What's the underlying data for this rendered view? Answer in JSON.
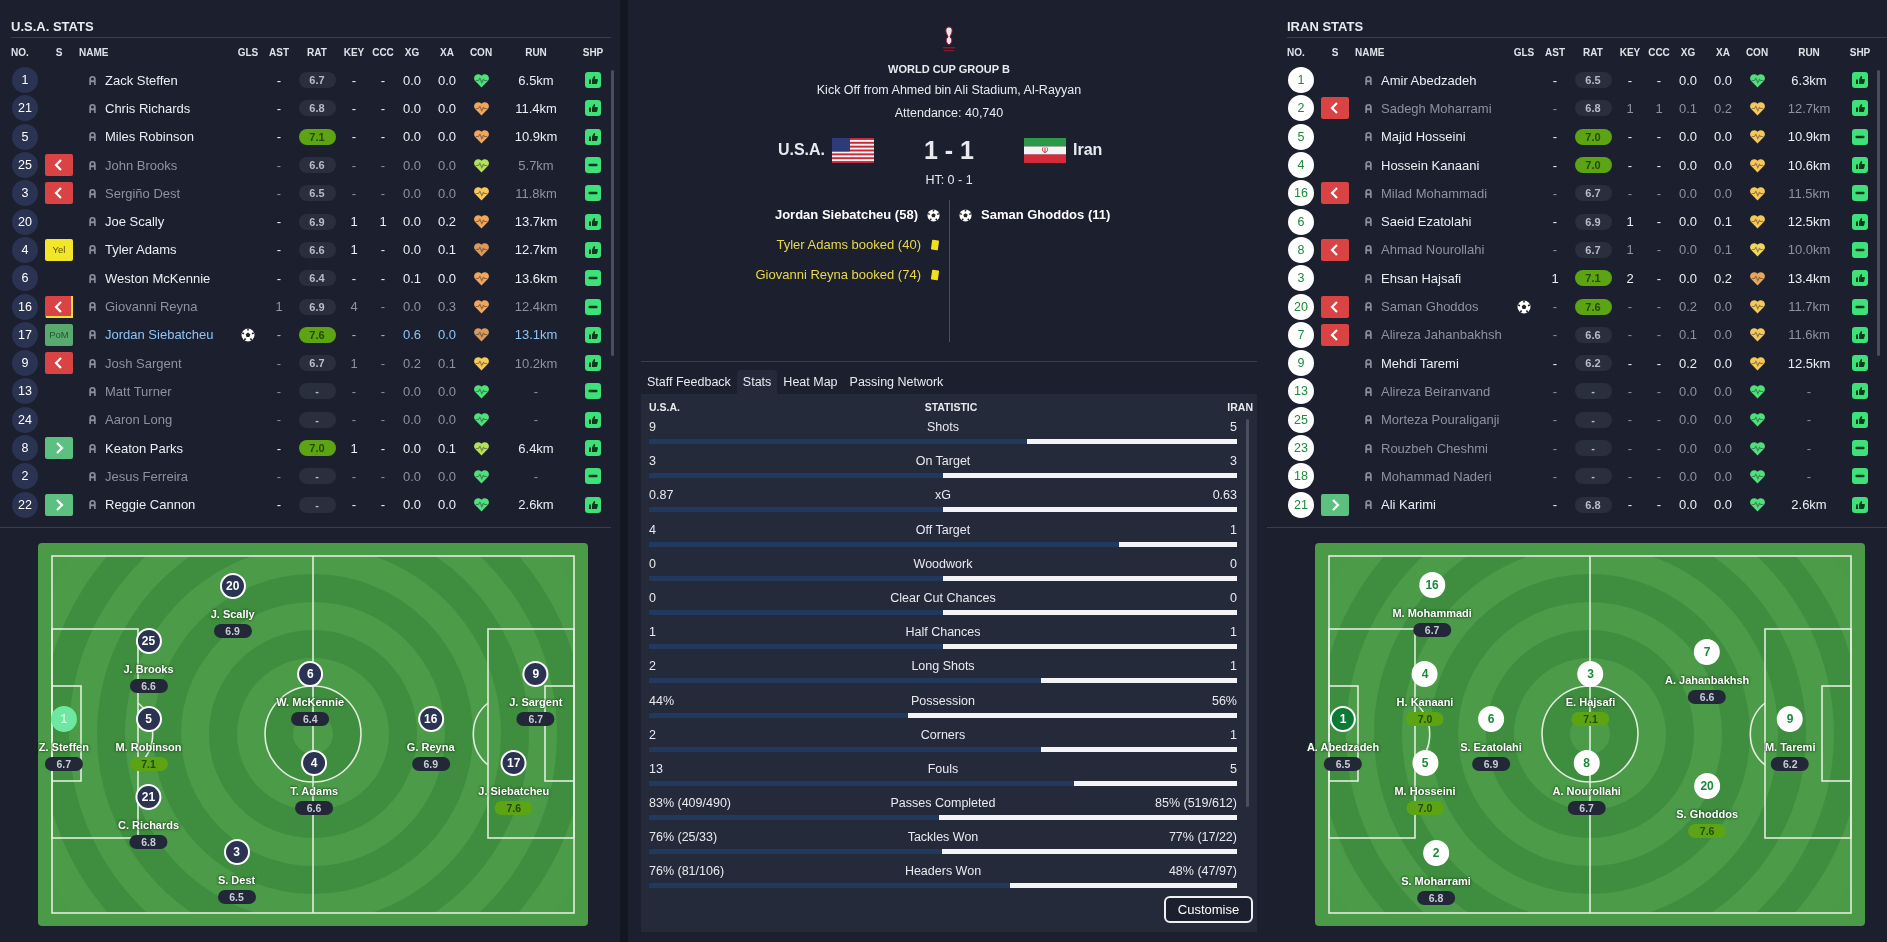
{
  "teams": [
    {
      "title": "U.S.A. STATS",
      "kind": "dark",
      "columns": [
        "NO.",
        "S",
        "NAME",
        "GLS",
        "AST",
        "RAT",
        "KEY",
        "CCC",
        "XG",
        "XA",
        "CON",
        "RUN",
        "SHP"
      ],
      "players": [
        {
          "no": "1",
          "name": "Zack Steffen",
          "status": {
            "kind": "none"
          },
          "booked": false,
          "faded": false,
          "highlighted": false,
          "scored": false,
          "ast": "-",
          "rat": "6.7",
          "rat_good": false,
          "key": "-",
          "ccc": "-",
          "xg": "0.0",
          "xa": "0.0",
          "condition": {
            "color": "#4fe07a"
          },
          "run": "6.5km",
          "shp": {
            "kind": "up"
          }
        },
        {
          "no": "21",
          "name": "Chris Richards",
          "status": {
            "kind": "none"
          },
          "booked": false,
          "faded": false,
          "highlighted": false,
          "scored": false,
          "ast": "-",
          "rat": "6.8",
          "rat_good": false,
          "key": "-",
          "ccc": "-",
          "xg": "0.0",
          "xa": "0.0",
          "condition": {
            "color": "#f2a65a"
          },
          "run": "11.4km",
          "shp": {
            "kind": "up"
          }
        },
        {
          "no": "5",
          "name": "Miles Robinson",
          "status": {
            "kind": "none"
          },
          "booked": false,
          "faded": false,
          "highlighted": false,
          "scored": false,
          "ast": "-",
          "rat": "7.1",
          "rat_good": true,
          "key": "-",
          "ccc": "-",
          "xg": "0.0",
          "xa": "0.0",
          "condition": {
            "color": "#f2a65a"
          },
          "run": "10.9km",
          "shp": {
            "kind": "up"
          }
        },
        {
          "no": "25",
          "name": "John Brooks",
          "status": {
            "kind": "off"
          },
          "booked": false,
          "faded": true,
          "highlighted": false,
          "scored": false,
          "ast": "-",
          "rat": "6.6",
          "rat_good": false,
          "key": "-",
          "ccc": "-",
          "xg": "0.0",
          "xa": "0.0",
          "condition": {
            "color": "#b5e05a"
          },
          "run": "5.7km",
          "shp": {
            "kind": "neutral"
          }
        },
        {
          "no": "3",
          "name": "Sergiño Dest",
          "status": {
            "kind": "off"
          },
          "booked": false,
          "faded": true,
          "highlighted": false,
          "scored": false,
          "ast": "-",
          "rat": "6.5",
          "rat_good": false,
          "key": "-",
          "ccc": "-",
          "xg": "0.0",
          "xa": "0.0",
          "condition": {
            "color": "#f6c85a"
          },
          "run": "11.8km",
          "shp": {
            "kind": "neutral"
          }
        },
        {
          "no": "20",
          "name": "Joe Scally",
          "status": {
            "kind": "none"
          },
          "booked": false,
          "faded": false,
          "highlighted": false,
          "scored": false,
          "ast": "-",
          "rat": "6.9",
          "rat_good": false,
          "key": "1",
          "ccc": "1",
          "xg": "0.0",
          "xa": "0.2",
          "condition": {
            "color": "#f2a65a"
          },
          "run": "13.7km",
          "shp": {
            "kind": "up"
          }
        },
        {
          "no": "4",
          "name": "Tyler Adams",
          "status": {
            "kind": "card",
            "text": "Yel"
          },
          "booked": false,
          "faded": false,
          "highlighted": false,
          "scored": false,
          "ast": "-",
          "rat": "6.6",
          "rat_good": false,
          "key": "1",
          "ccc": "-",
          "xg": "0.0",
          "xa": "0.1",
          "condition": {
            "color": "#d99a5a"
          },
          "run": "12.7km",
          "shp": {
            "kind": "up"
          }
        },
        {
          "no": "6",
          "name": "Weston McKennie",
          "status": {
            "kind": "none"
          },
          "booked": false,
          "faded": false,
          "highlighted": false,
          "scored": false,
          "ast": "-",
          "rat": "6.4",
          "rat_good": false,
          "key": "-",
          "ccc": "-",
          "xg": "0.1",
          "xa": "0.0",
          "condition": {
            "color": "#f2a65a"
          },
          "run": "13.6km",
          "shp": {
            "kind": "neutral"
          }
        },
        {
          "no": "16",
          "name": "Giovanni Reyna",
          "status": {
            "kind": "off"
          },
          "booked": true,
          "faded": true,
          "highlighted": false,
          "scored": false,
          "ast": "1",
          "rat": "6.9",
          "rat_good": false,
          "key": "4",
          "ccc": "-",
          "xg": "0.0",
          "xa": "0.3",
          "condition": {
            "color": "#f2a65a"
          },
          "run": "12.4km",
          "shp": {
            "kind": "neutral"
          }
        },
        {
          "no": "17",
          "name": "Jordan Siebatcheu",
          "status": {
            "kind": "award",
            "text": "PoM"
          },
          "booked": false,
          "faded": false,
          "highlighted": true,
          "scored": true,
          "ast": "-",
          "rat": "7.6",
          "rat_good": true,
          "key": "-",
          "ccc": "-",
          "xg": "0.6",
          "xa": "0.0",
          "condition": {
            "color": "#d99a5a"
          },
          "run": "13.1km",
          "shp": {
            "kind": "up"
          }
        },
        {
          "no": "9",
          "name": "Josh Sargent",
          "status": {
            "kind": "off"
          },
          "booked": false,
          "faded": true,
          "highlighted": false,
          "scored": false,
          "ast": "-",
          "rat": "6.7",
          "rat_good": false,
          "key": "1",
          "ccc": "-",
          "xg": "0.2",
          "xa": "0.1",
          "condition": {
            "color": "#f6c85a"
          },
          "run": "10.2km",
          "shp": {
            "kind": "up"
          }
        },
        {
          "no": "13",
          "name": "Matt Turner",
          "status": {
            "kind": "none"
          },
          "booked": false,
          "faded": true,
          "highlighted": false,
          "scored": false,
          "ast": "-",
          "rat": "-",
          "rat_good": false,
          "key": "-",
          "ccc": "-",
          "xg": "0.0",
          "xa": "0.0",
          "condition": {
            "color": "#4fe07a"
          },
          "run": "-",
          "shp": {
            "kind": "neutral"
          }
        },
        {
          "no": "24",
          "name": "Aaron Long",
          "status": {
            "kind": "none"
          },
          "booked": false,
          "faded": true,
          "highlighted": false,
          "scored": false,
          "ast": "-",
          "rat": "-",
          "rat_good": false,
          "key": "-",
          "ccc": "-",
          "xg": "0.0",
          "xa": "0.0",
          "condition": {
            "color": "#4fe07a"
          },
          "run": "-",
          "shp": {
            "kind": "up"
          }
        },
        {
          "no": "8",
          "name": "Keaton Parks",
          "status": {
            "kind": "on"
          },
          "booked": false,
          "faded": false,
          "highlighted": false,
          "scored": false,
          "ast": "-",
          "rat": "7.0",
          "rat_good": true,
          "key": "1",
          "ccc": "-",
          "xg": "0.0",
          "xa": "0.1",
          "condition": {
            "color": "#b5e05a"
          },
          "run": "6.4km",
          "shp": {
            "kind": "up"
          }
        },
        {
          "no": "2",
          "name": "Jesus Ferreira",
          "status": {
            "kind": "none"
          },
          "booked": false,
          "faded": true,
          "highlighted": false,
          "scored": false,
          "ast": "-",
          "rat": "-",
          "rat_good": false,
          "key": "-",
          "ccc": "-",
          "xg": "0.0",
          "xa": "0.0",
          "condition": {
            "color": "#4fe07a"
          },
          "run": "-",
          "shp": {
            "kind": "neutral"
          }
        },
        {
          "no": "22",
          "name": "Reggie Cannon",
          "status": {
            "kind": "on"
          },
          "booked": false,
          "faded": false,
          "highlighted": false,
          "scored": false,
          "ast": "-",
          "rat": "-",
          "rat_good": false,
          "key": "-",
          "ccc": "-",
          "xg": "0.0",
          "xa": "0.0",
          "condition": {
            "color": "#4fe07a"
          },
          "run": "2.6km",
          "shp": {
            "kind": "up"
          }
        }
      ],
      "pitch": [
        {
          "no": "1",
          "label": "Z. Steffen",
          "rating": "6.7",
          "good": false,
          "kind": "goalkeeper"
        },
        {
          "no": "25",
          "label": "J. Brooks",
          "rating": "6.6",
          "good": false,
          "kind": "outfield"
        },
        {
          "no": "5",
          "label": "M. Robinson",
          "rating": "7.1",
          "good": true,
          "kind": "outfield"
        },
        {
          "no": "21",
          "label": "C. Richards",
          "rating": "6.8",
          "good": false,
          "kind": "outfield"
        },
        {
          "no": "20",
          "label": "J. Scally",
          "rating": "6.9",
          "good": false,
          "kind": "outfield"
        },
        {
          "no": "3",
          "label": "S. Dest",
          "rating": "6.5",
          "good": false,
          "kind": "outfield"
        },
        {
          "no": "6",
          "label": "W. McKennie",
          "rating": "6.4",
          "good": false,
          "kind": "outfield"
        },
        {
          "no": "4",
          "label": "T. Adams",
          "rating": "6.6",
          "good": false,
          "kind": "outfield"
        },
        {
          "no": "16",
          "label": "G. Reyna",
          "rating": "6.9",
          "good": false,
          "kind": "outfield"
        },
        {
          "no": "9",
          "label": "J. Sargent",
          "rating": "6.7",
          "good": false,
          "kind": "outfield"
        },
        {
          "no": "17",
          "label": "J. Siebatcheu",
          "rating": "7.6",
          "good": true,
          "kind": "outfield"
        }
      ]
    },
    {
      "title": "IRAN STATS",
      "kind": "light",
      "columns": [
        "NO.",
        "S",
        "NAME",
        "GLS",
        "AST",
        "RAT",
        "KEY",
        "CCC",
        "XG",
        "XA",
        "CON",
        "RUN",
        "SHP"
      ],
      "players": [
        {
          "no": "1",
          "name": "Amir Abedzadeh",
          "status": {
            "kind": "none"
          },
          "booked": false,
          "faded": false,
          "highlighted": false,
          "scored": false,
          "ast": "-",
          "rat": "6.5",
          "rat_good": false,
          "key": "-",
          "ccc": "-",
          "xg": "0.0",
          "xa": "0.0",
          "condition": {
            "color": "#4fe07a"
          },
          "run": "6.3km",
          "shp": {
            "kind": "up"
          }
        },
        {
          "no": "2",
          "name": "Sadegh Moharrami",
          "status": {
            "kind": "off"
          },
          "booked": false,
          "faded": true,
          "highlighted": false,
          "scored": false,
          "ast": "-",
          "rat": "6.8",
          "rat_good": false,
          "key": "1",
          "ccc": "1",
          "xg": "0.1",
          "xa": "0.2",
          "condition": {
            "color": "#f6c85a"
          },
          "run": "12.7km",
          "shp": {
            "kind": "up"
          }
        },
        {
          "no": "5",
          "name": "Majid Hosseini",
          "status": {
            "kind": "none"
          },
          "booked": false,
          "faded": false,
          "highlighted": false,
          "scored": false,
          "ast": "-",
          "rat": "7.0",
          "rat_good": true,
          "key": "-",
          "ccc": "-",
          "xg": "0.0",
          "xa": "0.0",
          "condition": {
            "color": "#f6c85a"
          },
          "run": "10.9km",
          "shp": {
            "kind": "neutral"
          }
        },
        {
          "no": "4",
          "name": "Hossein Kanaani",
          "status": {
            "kind": "none"
          },
          "booked": false,
          "faded": false,
          "highlighted": false,
          "scored": false,
          "ast": "-",
          "rat": "7.0",
          "rat_good": true,
          "key": "-",
          "ccc": "-",
          "xg": "0.0",
          "xa": "0.0",
          "condition": {
            "color": "#f6c85a"
          },
          "run": "10.6km",
          "shp": {
            "kind": "up"
          }
        },
        {
          "no": "16",
          "name": "Milad Mohammadi",
          "status": {
            "kind": "off"
          },
          "booked": false,
          "faded": true,
          "highlighted": false,
          "scored": false,
          "ast": "-",
          "rat": "6.7",
          "rat_good": false,
          "key": "-",
          "ccc": "-",
          "xg": "0.0",
          "xa": "0.0",
          "condition": {
            "color": "#f6c85a"
          },
          "run": "11.5km",
          "shp": {
            "kind": "neutral"
          }
        },
        {
          "no": "6",
          "name": "Saeid Ezatolahi",
          "status": {
            "kind": "none"
          },
          "booked": false,
          "faded": false,
          "highlighted": false,
          "scored": false,
          "ast": "-",
          "rat": "6.9",
          "rat_good": false,
          "key": "1",
          "ccc": "-",
          "xg": "0.0",
          "xa": "0.1",
          "condition": {
            "color": "#f6c85a"
          },
          "run": "12.5km",
          "shp": {
            "kind": "up"
          }
        },
        {
          "no": "8",
          "name": "Ahmad Nourollahi",
          "status": {
            "kind": "off"
          },
          "booked": false,
          "faded": true,
          "highlighted": false,
          "scored": false,
          "ast": "-",
          "rat": "6.7",
          "rat_good": false,
          "key": "1",
          "ccc": "-",
          "xg": "0.0",
          "xa": "0.1",
          "condition": {
            "color": "#f0d860"
          },
          "run": "10.0km",
          "shp": {
            "kind": "neutral"
          }
        },
        {
          "no": "3",
          "name": "Ehsan Hajsafi",
          "status": {
            "kind": "none"
          },
          "booked": false,
          "faded": false,
          "highlighted": false,
          "scored": false,
          "ast": "1",
          "rat": "7.1",
          "rat_good": true,
          "key": "2",
          "ccc": "-",
          "xg": "0.0",
          "xa": "0.2",
          "condition": {
            "color": "#e8a85a"
          },
          "run": "13.4km",
          "shp": {
            "kind": "up"
          }
        },
        {
          "no": "20",
          "name": "Saman Ghoddos",
          "status": {
            "kind": "off"
          },
          "booked": false,
          "faded": true,
          "highlighted": false,
          "scored": true,
          "ast": "-",
          "rat": "7.6",
          "rat_good": true,
          "key": "-",
          "ccc": "-",
          "xg": "0.2",
          "xa": "0.0",
          "condition": {
            "color": "#f6c85a"
          },
          "run": "11.7km",
          "shp": {
            "kind": "neutral"
          }
        },
        {
          "no": "7",
          "name": "Alireza Jahanbakhsh",
          "status": {
            "kind": "off"
          },
          "booked": false,
          "faded": true,
          "highlighted": false,
          "scored": false,
          "ast": "-",
          "rat": "6.6",
          "rat_good": false,
          "key": "-",
          "ccc": "-",
          "xg": "0.1",
          "xa": "0.0",
          "condition": {
            "color": "#f6c85a"
          },
          "run": "11.6km",
          "shp": {
            "kind": "up"
          }
        },
        {
          "no": "9",
          "name": "Mehdi Taremi",
          "status": {
            "kind": "none"
          },
          "booked": false,
          "faded": false,
          "highlighted": false,
          "scored": false,
          "ast": "-",
          "rat": "6.2",
          "rat_good": false,
          "key": "-",
          "ccc": "-",
          "xg": "0.2",
          "xa": "0.0",
          "condition": {
            "color": "#f6c85a"
          },
          "run": "12.5km",
          "shp": {
            "kind": "up"
          }
        },
        {
          "no": "13",
          "name": "Alireza Beiranvand",
          "status": {
            "kind": "none"
          },
          "booked": false,
          "faded": true,
          "highlighted": false,
          "scored": false,
          "ast": "-",
          "rat": "-",
          "rat_good": false,
          "key": "-",
          "ccc": "-",
          "xg": "0.0",
          "xa": "0.0",
          "condition": {
            "color": "#4fe07a"
          },
          "run": "-",
          "shp": {
            "kind": "up"
          }
        },
        {
          "no": "25",
          "name": "Morteza Pouraliganji",
          "status": {
            "kind": "none"
          },
          "booked": false,
          "faded": true,
          "highlighted": false,
          "scored": false,
          "ast": "-",
          "rat": "-",
          "rat_good": false,
          "key": "-",
          "ccc": "-",
          "xg": "0.0",
          "xa": "0.0",
          "condition": {
            "color": "#4fe07a"
          },
          "run": "-",
          "shp": {
            "kind": "up"
          }
        },
        {
          "no": "23",
          "name": "Rouzbeh Cheshmi",
          "status": {
            "kind": "none"
          },
          "booked": false,
          "faded": true,
          "highlighted": false,
          "scored": false,
          "ast": "-",
          "rat": "-",
          "rat_good": false,
          "key": "-",
          "ccc": "-",
          "xg": "0.0",
          "xa": "0.0",
          "condition": {
            "color": "#4fe07a"
          },
          "run": "-",
          "shp": {
            "kind": "neutral"
          }
        },
        {
          "no": "18",
          "name": "Mohammad Naderi",
          "status": {
            "kind": "none"
          },
          "booked": false,
          "faded": true,
          "highlighted": false,
          "scored": false,
          "ast": "-",
          "rat": "-",
          "rat_good": false,
          "key": "-",
          "ccc": "-",
          "xg": "0.0",
          "xa": "0.0",
          "condition": {
            "color": "#4fe07a"
          },
          "run": "-",
          "shp": {
            "kind": "neutral"
          }
        },
        {
          "no": "21",
          "name": "Ali Karimi",
          "status": {
            "kind": "on"
          },
          "booked": false,
          "faded": false,
          "highlighted": false,
          "scored": false,
          "ast": "-",
          "rat": "6.8",
          "rat_good": false,
          "key": "-",
          "ccc": "-",
          "xg": "0.0",
          "xa": "0.0",
          "condition": {
            "color": "#4fe07a"
          },
          "run": "2.6km",
          "shp": {
            "kind": "up"
          }
        }
      ],
      "pitch": [
        {
          "no": "1",
          "label": "A. Abedzadeh",
          "rating": "6.5",
          "good": false,
          "kind": "goalkeeper"
        },
        {
          "no": "16",
          "label": "M. Mohammadi",
          "rating": "6.7",
          "good": false,
          "kind": "outfield"
        },
        {
          "no": "4",
          "label": "H. Kanaani",
          "rating": "7.0",
          "good": true,
          "kind": "outfield"
        },
        {
          "no": "5",
          "label": "M. Hosseini",
          "rating": "7.0",
          "good": true,
          "kind": "outfield"
        },
        {
          "no": "2",
          "label": "S. Moharrami",
          "rating": "6.8",
          "good": false,
          "kind": "outfield"
        },
        {
          "no": "6",
          "label": "S. Ezatolahi",
          "rating": "6.9",
          "good": false,
          "kind": "outfield"
        },
        {
          "no": "3",
          "label": "E. Hajsafi",
          "rating": "7.1",
          "good": true,
          "kind": "outfield"
        },
        {
          "no": "8",
          "label": "A. Nourollahi",
          "rating": "6.7",
          "good": false,
          "kind": "outfield"
        },
        {
          "no": "7",
          "label": "A. Jahanbakhsh",
          "rating": "6.6",
          "good": false,
          "kind": "outfield"
        },
        {
          "no": "20",
          "label": "S. Ghoddos",
          "rating": "7.6",
          "good": true,
          "kind": "outfield"
        },
        {
          "no": "9",
          "label": "M. Taremi",
          "rating": "6.2",
          "good": false,
          "kind": "outfield"
        }
      ]
    }
  ],
  "match": {
    "competition": "WORLD CUP GROUP B",
    "venue": "Kick Off from Ahmed bin Ali Stadium, Al-Rayyan",
    "attendance": "Attendance: 40,740",
    "home": "U.S.A.",
    "score": "1 - 1",
    "away": "Iran",
    "half_time": "HT: 0 - 1",
    "home_events": [
      {
        "kind": "goal",
        "text": "Jordan Siebatcheu (58)"
      },
      {
        "kind": "yellow",
        "text": "Tyler Adams booked (40)"
      },
      {
        "kind": "yellow",
        "text": "Giovanni Reyna booked (74)"
      }
    ],
    "away_events": [
      {
        "kind": "goal",
        "text": "Saman Ghoddos (11)"
      }
    ]
  },
  "tabs": [
    {
      "label": "Staff Feedback",
      "selected": false
    },
    {
      "label": "Stats",
      "selected": true
    },
    {
      "label": "Heat Map",
      "selected": false
    },
    {
      "label": "Passing Network",
      "selected": false
    }
  ],
  "stats": {
    "columns": [
      "U.S.A.",
      "STATISTIC",
      "IRAN"
    ],
    "rows": [
      {
        "home": "9",
        "label": "Shots",
        "away": "5",
        "level": 0.357
      },
      {
        "home": "3",
        "label": "On Target",
        "away": "3",
        "level": 0.5
      },
      {
        "home": "0.87",
        "label": "xG",
        "away": "0.63",
        "level": 0.5
      },
      {
        "home": "4",
        "label": "Off Target",
        "away": "1",
        "level": 0.2
      },
      {
        "home": "0",
        "label": "Woodwork",
        "away": "0",
        "level": 0.5
      },
      {
        "home": "0",
        "label": "Clear Cut Chances",
        "away": "0",
        "level": 0.5
      },
      {
        "home": "1",
        "label": "Half Chances",
        "away": "1",
        "level": 0.5
      },
      {
        "home": "2",
        "label": "Long Shots",
        "away": "1",
        "level": 0.333
      },
      {
        "home": "44%",
        "label": "Possession",
        "away": "56%",
        "level": 0.56
      },
      {
        "home": "2",
        "label": "Corners",
        "away": "1",
        "level": 0.333
      },
      {
        "home": "13",
        "label": "Fouls",
        "away": "5",
        "level": 0.278
      },
      {
        "home": "83% (409/490)",
        "label": "Passes Completed",
        "away": "85% (519/612)",
        "level": 0.506
      },
      {
        "home": "76% (25/33)",
        "label": "Tackles Won",
        "away": "77% (17/22)",
        "level": 0.502
      },
      {
        "home": "76% (81/106)",
        "label": "Headers Won",
        "away": "48% (47/97)",
        "level": 0.386
      }
    ],
    "button": "Customise"
  }
}
